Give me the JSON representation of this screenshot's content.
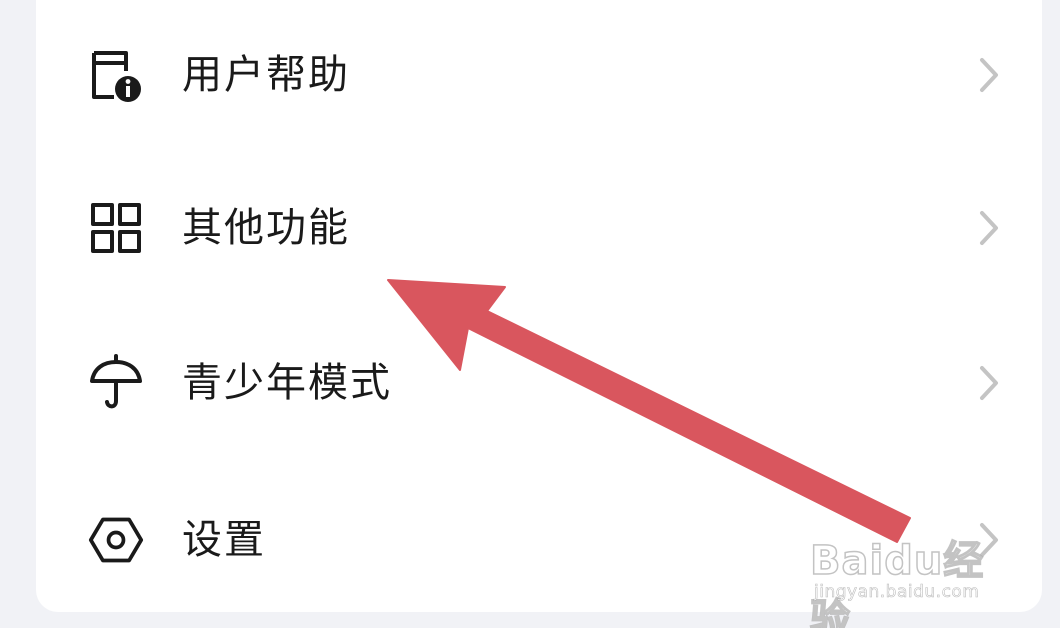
{
  "menu": {
    "items": [
      {
        "label": "用户帮助",
        "icon": "help-doc-icon"
      },
      {
        "label": "其他功能",
        "icon": "grid-icon"
      },
      {
        "label": "青少年模式",
        "icon": "umbrella-icon"
      },
      {
        "label": "设置",
        "icon": "settings-icon"
      }
    ]
  },
  "annotation": {
    "arrow_color": "#d9565e",
    "watermark_logo": "Baidu经验",
    "watermark_url": "jingyan.baidu.com"
  },
  "colors": {
    "background": "#f1f2f6",
    "card": "#ffffff",
    "text": "#1a1a1a",
    "chevron": "#c4c4c4"
  }
}
